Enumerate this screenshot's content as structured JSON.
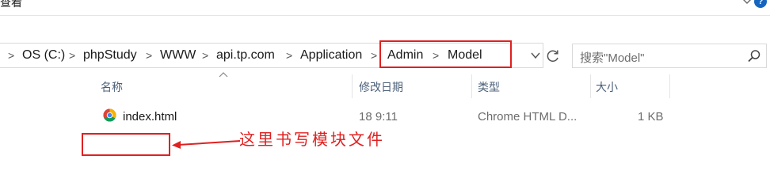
{
  "ribbon": {
    "tab_label": "查看"
  },
  "address": {
    "crumbs": [
      "OS (C:)",
      "phpStudy",
      "WWW",
      "api.tp.com",
      "Application",
      "Admin",
      "Model"
    ],
    "separator": ">"
  },
  "search": {
    "placeholder": "搜索\"Model\""
  },
  "columns": {
    "name": "名称",
    "modified": "修改日期",
    "type": "类型",
    "size": "大小"
  },
  "files": [
    {
      "name": "index.html",
      "modified": "18 9:11",
      "type": "Chrome HTML D...",
      "size": "1 KB",
      "icon": "chrome-icon"
    }
  ],
  "annotation": {
    "text": "这里书写模块文件",
    "color": "#e02020"
  },
  "colors": {
    "header_text": "#4c607a",
    "accent": "#1565c0",
    "annotation_red": "#e02020"
  }
}
